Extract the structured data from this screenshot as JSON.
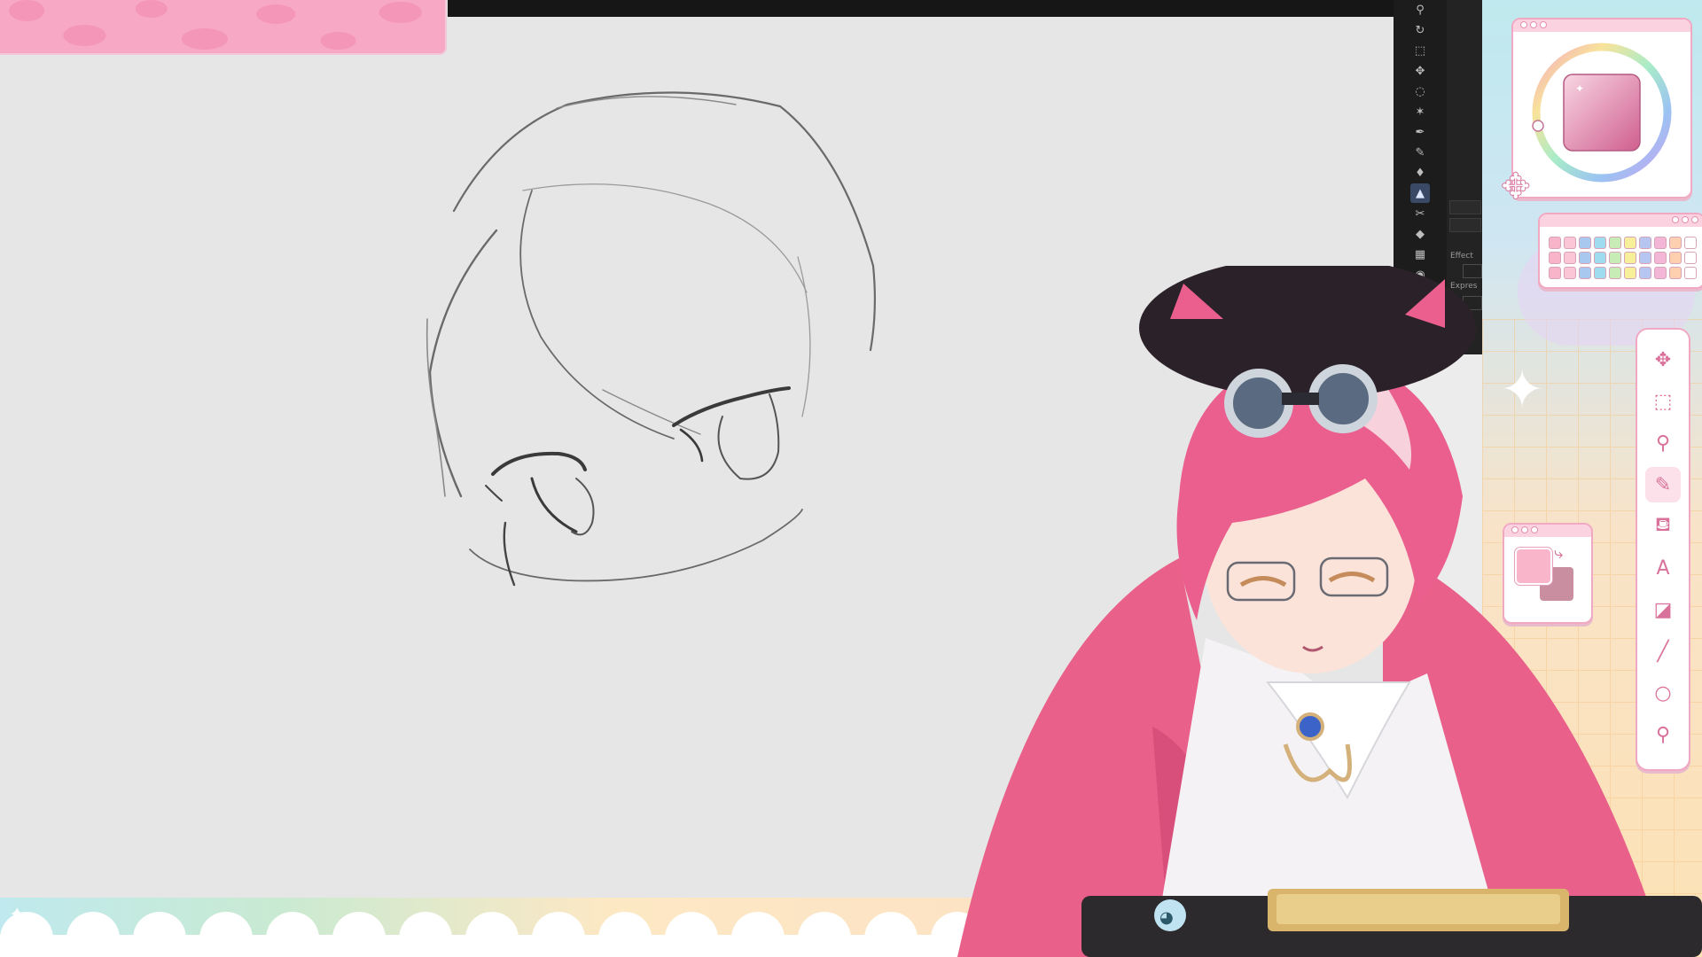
{
  "app": {
    "title": ""
  },
  "brush_tools": {
    "icons": [
      "zoom-icon",
      "rotate-icon",
      "object-icon",
      "move-icon",
      "lasso-icon",
      "magic-wand-icon",
      "pen-icon",
      "pencil-icon",
      "brush-icon",
      "airbrush-icon",
      "decoration-icon",
      "eraser-icon",
      "frame-border-icon",
      "fill-icon",
      "gradient-icon"
    ],
    "active_index": 9
  },
  "panel": {
    "effect_label": "Effect",
    "expression_label": "Expres"
  },
  "color": {
    "main": "#e47fae",
    "sub": "#c98fa0",
    "accent": "#f1a9c3"
  },
  "palette": {
    "rows": [
      [
        "#f8b4c8",
        "#fbc6d6",
        "#a9c8ef",
        "#9fdcef",
        "#c7ecb5",
        "#f8ef9b",
        "#b7c6f0",
        "#f3b6d6",
        "#ffd0b0",
        "#ffffff"
      ],
      [
        "#f8b4c8",
        "#fbc6d6",
        "#a9c8ef",
        "#9fdcef",
        "#c7ecb5",
        "#f8ef9b",
        "#b7c6f0",
        "#f3b6d6",
        "#ffd0b0",
        "#ffffff"
      ],
      [
        "#f8b4c8",
        "#fbc6d6",
        "#a9c8ef",
        "#9fdcef",
        "#c7ecb5",
        "#f8ef9b",
        "#b7c6f0",
        "#f3b6d6",
        "#ffd0b0",
        "#ffffff"
      ]
    ]
  },
  "tool_window": {
    "icons": [
      {
        "name": "move-icon",
        "glyph": "✥"
      },
      {
        "name": "selection-icon",
        "glyph": "⬚"
      },
      {
        "name": "eyedropper-icon",
        "glyph": "⚲"
      },
      {
        "name": "pencil-icon",
        "glyph": "✎"
      },
      {
        "name": "fill-bucket-icon",
        "glyph": "⛾"
      },
      {
        "name": "text-icon",
        "glyph": "A"
      },
      {
        "name": "eraser-icon",
        "glyph": "◪"
      },
      {
        "name": "line-icon",
        "glyph": "╱"
      },
      {
        "name": "ellipse-icon",
        "glyph": "○"
      },
      {
        "name": "search-icon",
        "glyph": "⚲"
      }
    ],
    "active_index": 3
  }
}
